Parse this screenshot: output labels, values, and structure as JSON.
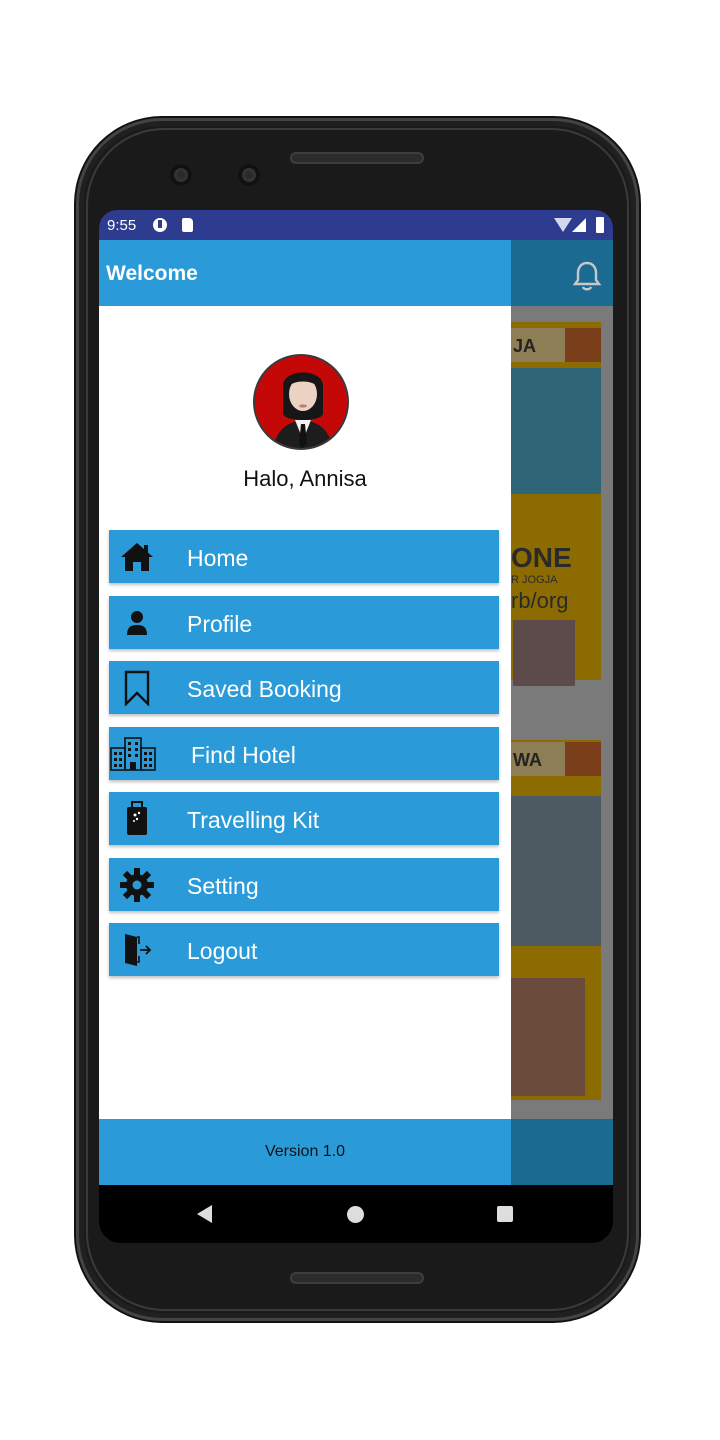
{
  "status_bar": {
    "time": "9:55"
  },
  "drawer": {
    "title": "Welcome",
    "greeting": "Halo, Annisa",
    "version": "Version 1.0",
    "items": [
      {
        "label": "Home",
        "icon": "home-icon"
      },
      {
        "label": "Profile",
        "icon": "person-icon"
      },
      {
        "label": "Saved Booking",
        "icon": "bookmark-icon"
      },
      {
        "label": "Find Hotel",
        "icon": "hotel-building-icon"
      },
      {
        "label": "Travelling Kit",
        "icon": "luggage-icon"
      },
      {
        "label": "Setting",
        "icon": "gear-icon"
      },
      {
        "label": "Logout",
        "icon": "logout-door-icon"
      }
    ]
  },
  "background_app": {
    "poster_labels": [
      "JA",
      "ONE",
      "R JOGJA",
      "rb/org",
      "WA"
    ],
    "icon": "bell-icon"
  },
  "colors": {
    "primary": "#2a9bd8",
    "status_bar": "#2e3c8f",
    "scrim_app_bar": "#1a6a92"
  }
}
